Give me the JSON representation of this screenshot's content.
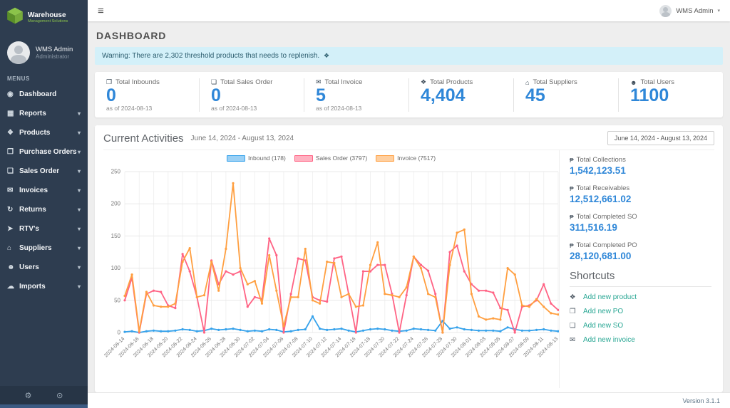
{
  "brand": {
    "line1": "Warehouse",
    "line2": "Management Solutions"
  },
  "topbar": {
    "menu_icon": "≡",
    "user_name": "WMS Admin",
    "chevron": "▾"
  },
  "sidebar": {
    "user": {
      "name": "WMS Admin",
      "role": "Administrator"
    },
    "menus_label": "MENUS",
    "items": [
      {
        "label": "Dashboard",
        "icon": "◉"
      },
      {
        "label": "Reports",
        "icon": "▦",
        "chevron": "▾"
      },
      {
        "label": "Products",
        "icon": "❖",
        "chevron": "▾"
      },
      {
        "label": "Purchase Orders",
        "icon": "❒",
        "chevron": "▾"
      },
      {
        "label": "Sales Order",
        "icon": "❏",
        "chevron": "▾"
      },
      {
        "label": "Invoices",
        "icon": "✉",
        "chevron": "▾"
      },
      {
        "label": "Returns",
        "icon": "↻",
        "chevron": "▾"
      },
      {
        "label": "RTV's",
        "icon": "➤",
        "chevron": "▾"
      },
      {
        "label": "Suppliers",
        "icon": "⌂",
        "chevron": "▾"
      },
      {
        "label": "Users",
        "icon": "☻",
        "chevron": "▾"
      },
      {
        "label": "Imports",
        "icon": "☁",
        "chevron": "▾"
      }
    ],
    "footer_icons": {
      "settings": "⚙",
      "power": "⊙"
    }
  },
  "page": {
    "title": "DASHBOARD",
    "warning_text": "Warning: There are 2,302 threshold products that needs to replenish.",
    "warning_icon": "❖"
  },
  "stats": [
    {
      "icon": "❒",
      "label": "Total Inbounds",
      "value": "0",
      "sub": "as of 2024-08-13"
    },
    {
      "icon": "❏",
      "label": "Total Sales Order",
      "value": "0",
      "sub": "as of 2024-08-13"
    },
    {
      "icon": "✉",
      "label": "Total Invoice",
      "value": "5",
      "sub": "as of 2024-08-13"
    },
    {
      "icon": "❖",
      "label": "Total Products",
      "value": "4,404",
      "sub": ""
    },
    {
      "icon": "⌂",
      "label": "Total Suppliers",
      "value": "45",
      "sub": ""
    },
    {
      "icon": "☻",
      "label": "Total Users",
      "value": "1100",
      "sub": ""
    }
  ],
  "activities": {
    "title": "Current Activities",
    "subtitle": "June 14, 2024 - August 13, 2024",
    "range_button": "June 14, 2024 - August 13, 2024"
  },
  "chart_data": {
    "type": "line",
    "title": "Current Activities",
    "xlabel": "",
    "ylabel": "",
    "ylim": [
      0,
      250
    ],
    "ytick": 50,
    "grid": true,
    "legend_position": "top",
    "x": [
      "2024-06-14",
      "2024-06-15",
      "2024-06-16",
      "2024-06-17",
      "2024-06-18",
      "2024-06-19",
      "2024-06-20",
      "2024-06-21",
      "2024-06-22",
      "2024-06-23",
      "2024-06-24",
      "2024-06-25",
      "2024-06-26",
      "2024-06-27",
      "2024-06-28",
      "2024-06-29",
      "2024-06-30",
      "2024-07-01",
      "2024-07-02",
      "2024-07-03",
      "2024-07-04",
      "2024-07-05",
      "2024-07-06",
      "2024-07-07",
      "2024-07-08",
      "2024-07-09",
      "2024-07-10",
      "2024-07-11",
      "2024-07-12",
      "2024-07-13",
      "2024-07-14",
      "2024-07-15",
      "2024-07-16",
      "2024-07-17",
      "2024-07-18",
      "2024-07-19",
      "2024-07-20",
      "2024-07-21",
      "2024-07-22",
      "2024-07-23",
      "2024-07-24",
      "2024-07-25",
      "2024-07-26",
      "2024-07-27",
      "2024-07-28",
      "2024-07-29",
      "2024-07-30",
      "2024-07-31",
      "2024-08-01",
      "2024-08-02",
      "2024-08-03",
      "2024-08-04",
      "2024-08-05",
      "2024-08-06",
      "2024-08-07",
      "2024-08-08",
      "2024-08-09",
      "2024-08-10",
      "2024-08-11",
      "2024-08-12",
      "2024-08-13"
    ],
    "label_every": 2,
    "series": [
      {
        "name": "Inbound",
        "legend": "Inbound (178)",
        "color": "#36a2eb",
        "values": [
          1,
          2,
          0,
          2,
          3,
          2,
          2,
          3,
          5,
          4,
          2,
          3,
          6,
          4,
          5,
          6,
          4,
          2,
          3,
          2,
          5,
          4,
          1,
          2,
          4,
          5,
          25,
          6,
          4,
          5,
          6,
          3,
          1,
          3,
          5,
          6,
          5,
          3,
          2,
          3,
          6,
          5,
          4,
          3,
          18,
          6,
          8,
          5,
          4,
          3,
          3,
          3,
          2,
          8,
          5,
          3,
          3,
          4,
          5,
          3,
          2
        ]
      },
      {
        "name": "Sales Order",
        "legend": "Sales Order (3797)",
        "color": "#ff6384",
        "values": [
          50,
          85,
          0,
          60,
          65,
          63,
          42,
          38,
          122,
          95,
          55,
          0,
          112,
          75,
          95,
          90,
          95,
          40,
          55,
          52,
          146,
          120,
          0,
          60,
          115,
          112,
          55,
          50,
          48,
          115,
          118,
          60,
          0,
          95,
          95,
          105,
          105,
          60,
          0,
          58,
          118,
          105,
          96,
          60,
          0,
          125,
          135,
          95,
          75,
          65,
          65,
          62,
          38,
          35,
          0,
          40,
          42,
          50,
          75,
          45,
          35
        ]
      },
      {
        "name": "Invoice",
        "legend": "Invoice (7517)",
        "color": "#ff9f40",
        "values": [
          57,
          90,
          2,
          63,
          42,
          40,
          40,
          45,
          110,
          131,
          55,
          58,
          110,
          65,
          130,
          232,
          100,
          75,
          80,
          45,
          120,
          65,
          10,
          55,
          55,
          130,
          50,
          45,
          110,
          108,
          55,
          60,
          40,
          42,
          105,
          140,
          60,
          58,
          55,
          70,
          118,
          100,
          60,
          55,
          0,
          105,
          155,
          160,
          60,
          25,
          20,
          22,
          20,
          100,
          90,
          42,
          40,
          52,
          40,
          30,
          28
        ]
      }
    ]
  },
  "totals": [
    {
      "icon": "₱",
      "label": "Total Collections",
      "value": "1,542,123.51"
    },
    {
      "icon": "₱",
      "label": "Total Receivables",
      "value": "12,512,661.02"
    },
    {
      "icon": "₱",
      "label": "Total Completed SO",
      "value": "311,516.19"
    },
    {
      "icon": "₱",
      "label": "Total Completed PO",
      "value": "28,120,681.00"
    }
  ],
  "shortcuts": {
    "title": "Shortcuts",
    "items": [
      {
        "icon": "❖",
        "label": "Add new product"
      },
      {
        "icon": "❒",
        "label": "Add new PO"
      },
      {
        "icon": "❏",
        "label": "Add new SO"
      },
      {
        "icon": "✉",
        "label": "Add new invoice"
      }
    ]
  },
  "footer": {
    "version": "Version 3.1.1"
  },
  "colors": {
    "accent": "#2f87d8",
    "sidebar": "#2e3d50",
    "warning_bg": "#d3f0f9",
    "shortcut_link": "#2aa794",
    "brand_green": "#8bc34a"
  }
}
